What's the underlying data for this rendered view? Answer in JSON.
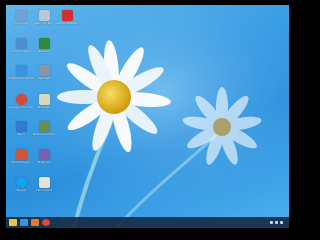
{
  "desktop": {
    "icons": [
      {
        "label": "Computer",
        "icon": "computer-icon",
        "color": "#6fa3d8"
      },
      {
        "label": "Recycle Bin",
        "icon": "recycle-bin-icon",
        "color": "#b9c7d6"
      },
      {
        "label": "Adobe Reader",
        "icon": "pdf-icon",
        "color": "#d2302c"
      },
      {
        "label": "Control Panel",
        "icon": "control-panel-icon",
        "color": "#4b8fd1"
      },
      {
        "label": "Network",
        "icon": "network-icon",
        "color": "#2f8a3a"
      },
      {
        "label": "Internet Explorer",
        "icon": "browser-icon",
        "color": "#3b92df"
      },
      {
        "label": "Settings",
        "icon": "settings-icon",
        "color": "#8c96a3"
      },
      {
        "label": "Google Chrome",
        "icon": "chrome-icon",
        "color": "#e0463a"
      },
      {
        "label": "Notepad",
        "icon": "notepad-icon",
        "color": "#d8d8c0"
      },
      {
        "label": "Wi-Fi",
        "icon": "wifi-icon",
        "color": "#2f7bd0"
      },
      {
        "label": "Network Share",
        "icon": "network-share-icon",
        "color": "#6b8e4e"
      },
      {
        "label": "Media Player",
        "icon": "media-player-icon",
        "color": "#d0533a"
      },
      {
        "label": "Program",
        "icon": "program-icon",
        "color": "#7a5fb3"
      },
      {
        "label": "Skype",
        "icon": "skype-icon",
        "color": "#1aa0e6"
      },
      {
        "label": "Document",
        "icon": "document-icon",
        "color": "#e8e2d0"
      }
    ]
  },
  "taskbar": {
    "items": [
      {
        "icon": "file-explorer-icon",
        "color": "#f0c040"
      },
      {
        "icon": "browser-taskbar-icon",
        "color": "#3b92df"
      },
      {
        "icon": "media-taskbar-icon",
        "color": "#e07a2c"
      },
      {
        "icon": "chrome-taskbar-icon",
        "color": "#e0463a"
      }
    ],
    "clock_time": "",
    "clock_date": ""
  },
  "colors": {
    "wallpaper_sky": "#3a9de3",
    "daisy_petals": "#ffffff",
    "daisy_center": "#f4c10f",
    "taskbar": "#122840"
  }
}
